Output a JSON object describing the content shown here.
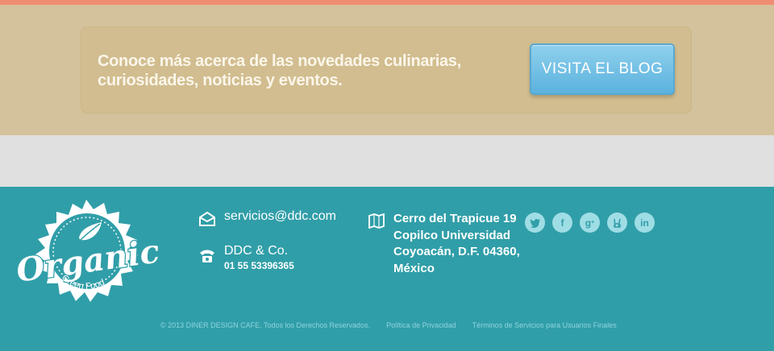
{
  "promo": {
    "line1": "Conoce más acerca de las novedades culinarias,",
    "line2": "curiosidades, noticias y eventos.",
    "button": "VISITA EL BLOG"
  },
  "logo": {
    "word": "Organic",
    "sub": "Green Food"
  },
  "contact": {
    "email": "servicios@ddc.com",
    "company": "DDC & Co.",
    "phone": "01 55 53396365"
  },
  "address": {
    "line1": "Cerro del Trapicue 19",
    "line2": "Copilco Universidad",
    "line3": "Coyoacán, D.F. 04360,",
    "line4": "México"
  },
  "social": {
    "twitter": "twitter-icon",
    "facebook": "facebook-icon",
    "googleplus": "googleplus-icon",
    "peace": "peace-icon",
    "linkedin": "linkedin-icon"
  },
  "legal": {
    "copyright": "© 2013 DINER DESIGN CAFE. Todos los Derechos Reservados.",
    "privacy": "Política de Privacidad",
    "terms": "Términos de Servicios para Usuarios Finales"
  },
  "colors": {
    "accent_strip": "#f08c72",
    "promo_bg": "#d4c29c",
    "button_blue": "#5bb2de",
    "footer_teal": "#309ea8",
    "social_circle": "#9fdde5"
  }
}
